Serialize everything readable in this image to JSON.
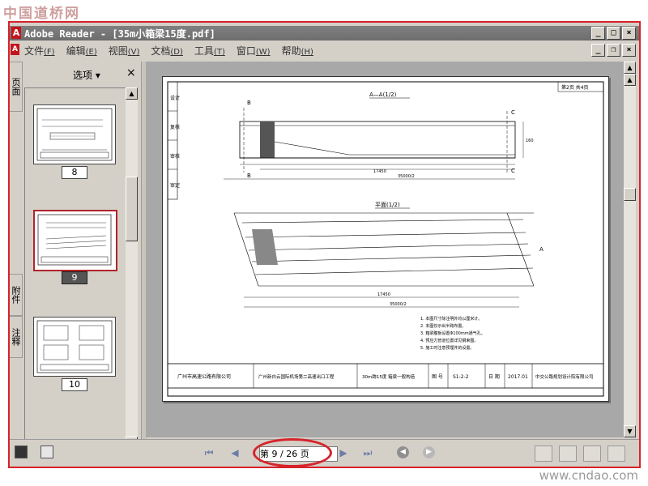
{
  "watermarks": {
    "top": "中国道桥网",
    "bottom": "www.cndao.com"
  },
  "window": {
    "title": "Adobe Reader - [35m小箱梁15度.pdf]",
    "app_icon": "adobe-reader-icon",
    "buttons": [
      "_",
      "□",
      "×"
    ]
  },
  "menu": {
    "items": [
      {
        "label": "文件",
        "key": "(F)"
      },
      {
        "label": "编辑",
        "key": "(E)"
      },
      {
        "label": "视图",
        "key": "(V)"
      },
      {
        "label": "文档",
        "key": "(D)"
      },
      {
        "label": "工具",
        "key": "(T)"
      },
      {
        "label": "窗口",
        "key": "(W)"
      },
      {
        "label": "帮助",
        "key": "(H)"
      }
    ],
    "doc_buttons": [
      "_",
      "❐",
      "×"
    ]
  },
  "side_tabs": {
    "pages": "页面",
    "attachments": "附件",
    "comments": "注释"
  },
  "nav_panel": {
    "options_label": "选项",
    "close": "×",
    "thumbnails": [
      {
        "label": "8",
        "selected": false
      },
      {
        "label": "9",
        "selected": true
      },
      {
        "label": "10",
        "selected": false
      }
    ]
  },
  "drawing": {
    "title_elevation": "A—A(1/2)",
    "title_plan": "平面(1/2)",
    "sheet_info": "第2页 共4页",
    "side_labels": [
      "设计",
      "复核",
      "审核",
      "审定"
    ],
    "titleblock": {
      "owner": "广州市高速公路有限公司",
      "project": "广州新白云国际机场第二高速出口工程",
      "drawing_name": "30m跨15度 箱梁一般构造",
      "label_no": "图 号",
      "no": "S1-2-2",
      "label_date": "日 期",
      "date": "2017.01",
      "designer": "中交公路规划设计院有限公司"
    },
    "notes": [
      "1. 本图尺寸除注明外均以厘米计。",
      "2. 本图仅示出半跨布置。",
      "3. 箱梁腹板设置Φ100mm通气孔。",
      "4. 预应力管道位置详见钢束图。",
      "5. 施工时注意预埋件的设置。"
    ]
  },
  "bottom": {
    "page_indicator": "第 9 / 26 页",
    "current_page": 9,
    "total_pages": 26,
    "highlight_color": "#d6232a"
  }
}
